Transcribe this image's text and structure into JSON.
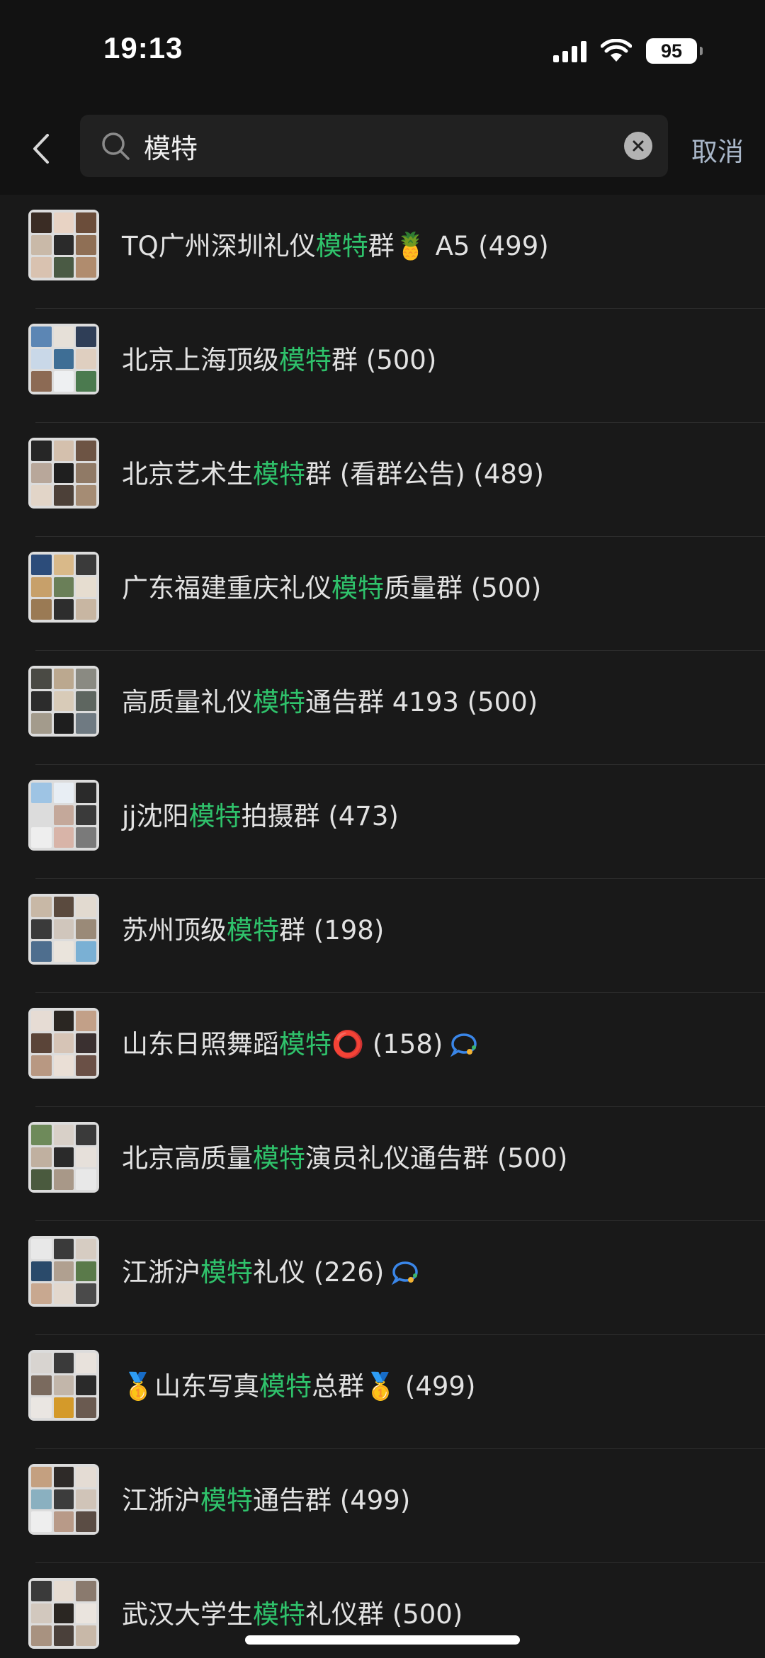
{
  "status_bar": {
    "time": "19:13",
    "battery": "95",
    "icons": [
      "signal-icon",
      "wifi-icon",
      "battery-icon"
    ]
  },
  "header": {
    "search_value": "模特",
    "search_icon": "search-icon",
    "clear_icon": "close-icon",
    "back_icon": "chevron-left-icon",
    "cancel_label": "取消"
  },
  "colors": {
    "highlight": "#2fc26b",
    "background": "#191919",
    "cancel": "#a9b7c9"
  },
  "results": [
    {
      "pre": "TQ广州深圳礼仪",
      "hl": "模特",
      "post": "群🍍 A5 (499)"
    },
    {
      "pre": "北京上海顶级",
      "hl": "模特",
      "post": "群 (500)"
    },
    {
      "pre": "北京艺术生",
      "hl": "模特",
      "post": "群 (看群公告) (489)"
    },
    {
      "pre": "广东福建重庆礼仪",
      "hl": "模特",
      "post": "质量群 (500)"
    },
    {
      "pre": "高质量礼仪",
      "hl": "模特",
      "post": "通告群 4193 (500)"
    },
    {
      "pre": "jj沈阳",
      "hl": "模特",
      "post": "拍摄群 (473)"
    },
    {
      "pre": "苏州顶级",
      "hl": "模特",
      "post": "群 (198)"
    },
    {
      "pre": "山东日照舞蹈",
      "hl": "模特",
      "post": "⭕ (158)",
      "badge": "chat-bubble-icon"
    },
    {
      "pre": "北京高质量",
      "hl": "模特",
      "post": "演员礼仪通告群 (500)"
    },
    {
      "pre": "江浙沪",
      "hl": "模特",
      "post": "礼仪 (226)",
      "badge": "chat-bubble-icon"
    },
    {
      "pre": "🥇山东写真",
      "hl": "模特",
      "post": "总群🥇 (499)"
    },
    {
      "pre": "江浙沪",
      "hl": "模特",
      "post": "通告群 (499)"
    },
    {
      "pre": "武汉大学生",
      "hl": "模特",
      "post": "礼仪群 (500)"
    }
  ]
}
